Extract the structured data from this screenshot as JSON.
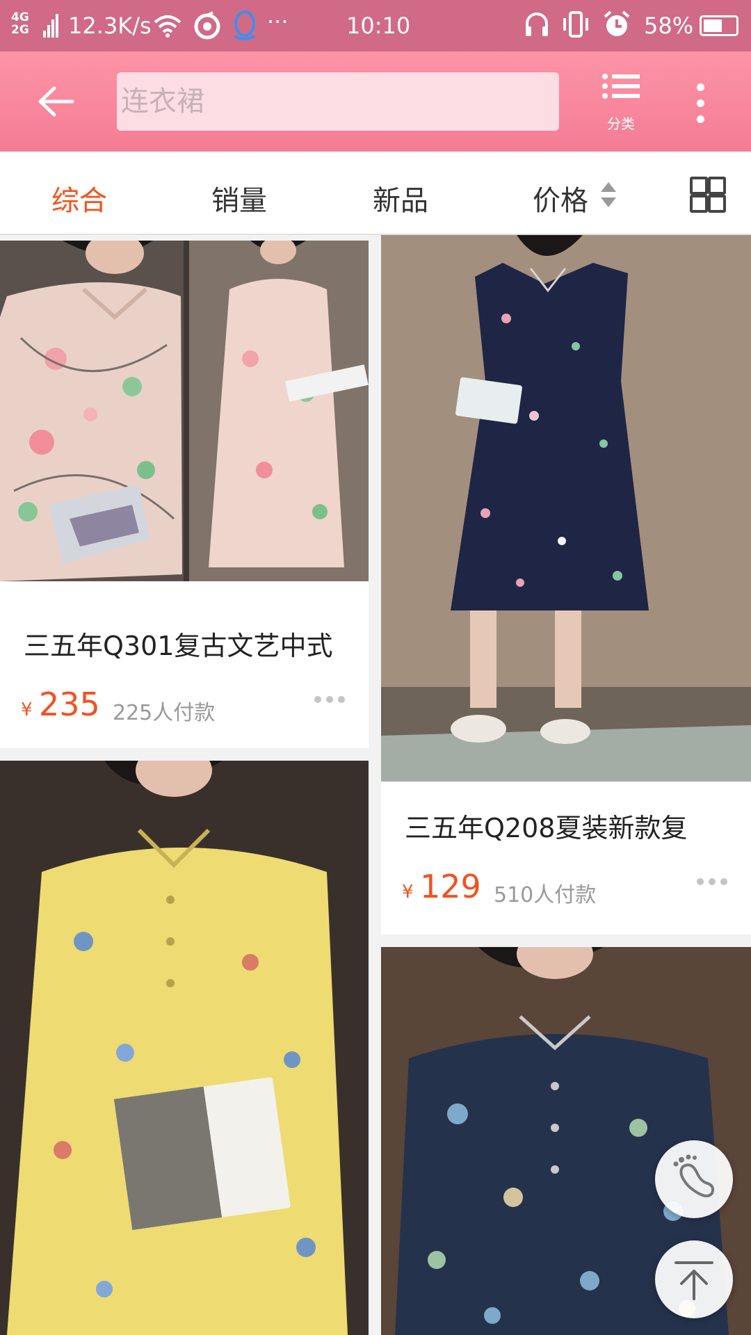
{
  "status_bar": {
    "network": "4G",
    "network2": "2G",
    "speed": "12.3K/s",
    "dots": "···",
    "time": "10:10",
    "battery": "58%",
    "battery_level": 0.58
  },
  "header": {
    "search_placeholder": "连衣裙",
    "category_label": "分类"
  },
  "sort_bar": {
    "tabs": [
      "综合",
      "销量",
      "新品",
      "价格"
    ]
  },
  "products": [
    {
      "title": "三五年Q301复古文艺中式",
      "currency": "¥",
      "price": "235",
      "sales": "225人付款"
    },
    {
      "title": "三五年Q208夏装新款复",
      "currency": "¥",
      "price": "129",
      "sales": "510人付款"
    }
  ],
  "colors": {
    "status_bar": "#d06a86",
    "header": "#f47c95",
    "accent": "#f4511e"
  }
}
